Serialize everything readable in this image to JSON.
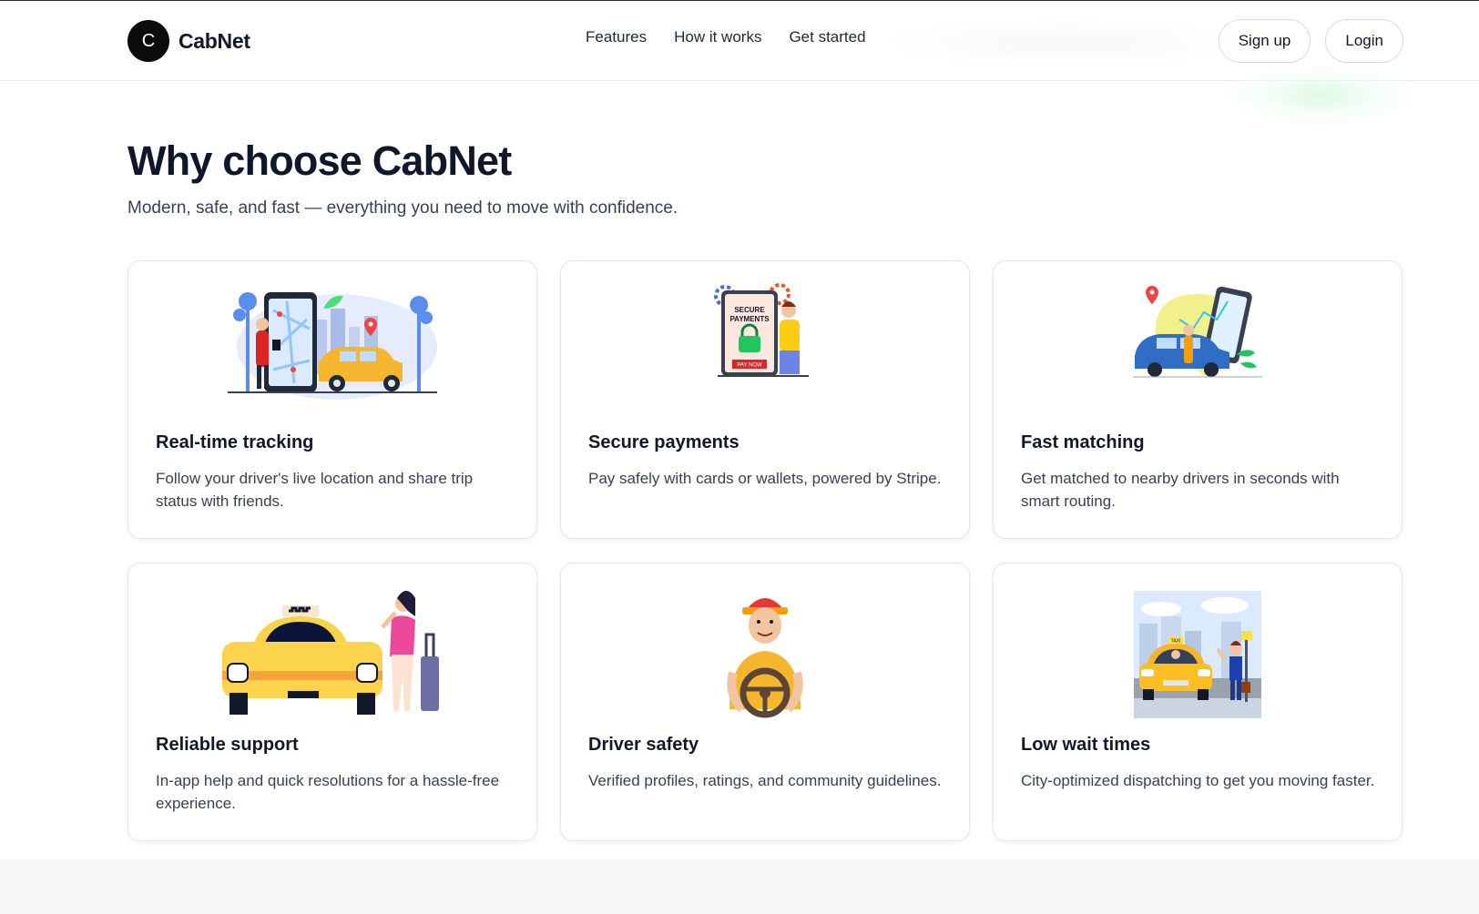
{
  "brand": {
    "logo_letter": "C",
    "name": "CabNet"
  },
  "nav": {
    "items": [
      "Features",
      "How it works",
      "Get started"
    ]
  },
  "actions": {
    "signup": "Sign up",
    "login": "Login"
  },
  "hero": {
    "title": "Why choose CabNet",
    "subtitle": "Modern, safe, and fast — everything you need to move with confidence."
  },
  "features": [
    {
      "title": "Real-time tracking",
      "description": "Follow your driver's live location and share trip status with friends.",
      "illustration": "map-tracking-taxi-illustration"
    },
    {
      "title": "Secure payments",
      "description": "Pay safely with cards or wallets, powered by Stripe.",
      "illustration": "secure-payments-phone-illustration",
      "illustration_text": {
        "line1": "SECURE",
        "line2": "PAYMENTS",
        "button": "PAY NOW"
      }
    },
    {
      "title": "Fast matching",
      "description": "Get matched to nearby drivers in seconds with smart routing.",
      "illustration": "driver-matching-car-illustration"
    },
    {
      "title": "Reliable support",
      "description": "In-app help and quick resolutions for a hassle-free experience.",
      "illustration": "taxi-passenger-luggage-illustration"
    },
    {
      "title": "Driver safety",
      "description": "Verified profiles, ratings, and community guidelines.",
      "illustration": "driver-steering-wheel-illustration"
    },
    {
      "title": "Low wait times",
      "description": "City-optimized dispatching to get you moving faster.",
      "illustration": "city-taxi-hailing-illustration",
      "illustration_text": {
        "sign": "TAXI"
      }
    }
  ],
  "colors": {
    "taxi_yellow": "#f5b52e",
    "dark_text": "#0f172a",
    "body_text": "#374151",
    "card_border": "#e3e6ea",
    "footer_band": "#f6f7f9"
  }
}
